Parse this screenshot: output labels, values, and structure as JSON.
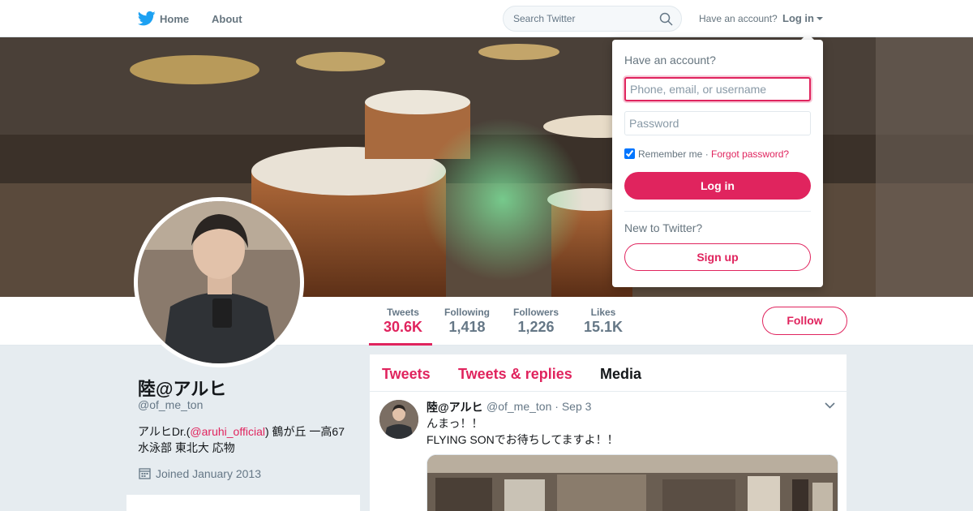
{
  "colors": {
    "accent": "#e0245e",
    "brand": "#1da1f2",
    "muted": "#657786",
    "background": "#e6ecf0"
  },
  "nav": {
    "home": "Home",
    "about": "About",
    "search_placeholder": "Search Twitter",
    "have_account": "Have an account?",
    "login": "Log in",
    "icons": {
      "logo": "twitter-bird-icon",
      "search": "search-icon",
      "caret": "caret-down-icon"
    }
  },
  "stats": [
    {
      "label": "Tweets",
      "value": "30.6K",
      "active": true
    },
    {
      "label": "Following",
      "value": "1,418",
      "active": false
    },
    {
      "label": "Followers",
      "value": "1,226",
      "active": false
    },
    {
      "label": "Likes",
      "value": "15.1K",
      "active": false
    }
  ],
  "follow_button": "Follow",
  "profile": {
    "name": "陸@アルヒ",
    "handle": "@of_me_ton",
    "bio_prefix": "アルヒDr.(",
    "bio_mention": "@aruhi_official",
    "bio_suffix": ") 鶴が丘 一高67",
    "bio_line2": "水泳部 東北大 応物",
    "joined": "Joined January 2013"
  },
  "timeline": {
    "tabs": [
      "Tweets",
      "Tweets & replies",
      "Media"
    ],
    "tweet": {
      "name": "陸@アルヒ",
      "handle": "@of_me_ton",
      "date": "Sep 3",
      "separator": "·",
      "text": "んまっ！！\nFLYING SONでお待ちしてますよ！！"
    }
  },
  "login_dropdown": {
    "title": "Have an account?",
    "username_placeholder": "Phone, email, or username",
    "password_placeholder": "Password",
    "remember_me": "Remember me",
    "separator": "·",
    "forgot_password": "Forgot password?",
    "login_button": "Log in",
    "new_to_twitter": "New to Twitter?",
    "signup_button": "Sign up"
  }
}
